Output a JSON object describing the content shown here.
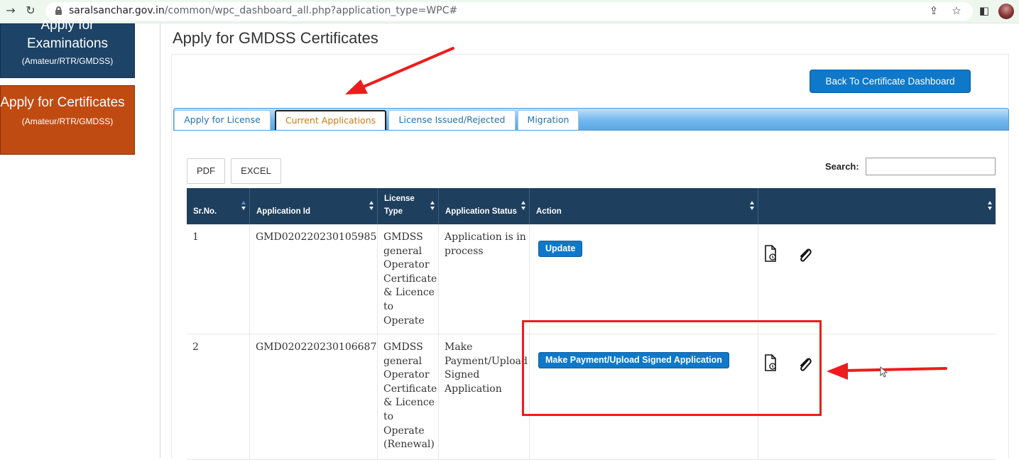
{
  "browser": {
    "url_host": "saralsanchar.gov.in",
    "url_path": "/common/wpc_dashboard_all.php?application_type=WPC#"
  },
  "sidebar": {
    "exam_title_line1": "Apply for",
    "exam_title_line2": "Examinations",
    "exam_sub": "(Amateur/RTR/GMDSS)",
    "cert_title": "Apply for Certificates",
    "cert_sub": "(Amateur/RTR/GMDSS)"
  },
  "page": {
    "title": "Apply for GMDSS Certificates",
    "back_button": "Back To Certificate Dashboard"
  },
  "tabs": [
    {
      "label": "Apply for License"
    },
    {
      "label": "Current Applications"
    },
    {
      "label": "License Issued/Rejected"
    },
    {
      "label": "Migration"
    }
  ],
  "toolbar": {
    "pdf_label": "PDF",
    "excel_label": "EXCEL",
    "search_label": "Search:",
    "search_value": ""
  },
  "table": {
    "headers": {
      "sr_no": "Sr.No.",
      "app_id": "Application Id",
      "license_type_1": "License",
      "license_type_2": "Type",
      "status": "Application Status",
      "action": "Action",
      "extra": ""
    },
    "rows": [
      {
        "sr_no": "1",
        "app_id": "GMD020220230105985",
        "license_type": "GMDSS general Operator Certificate & Licence to Operate",
        "status": "Application is in process",
        "action": "Update"
      },
      {
        "sr_no": "2",
        "app_id": "GMD020220230106687",
        "license_type": "GMDSS general Operator Certificate & Licence to Operate (Renewal)",
        "status": "Make Payment/Upload Signed Application",
        "action": "Make Payment/Upload Signed Application"
      }
    ]
  },
  "icons": [
    "forward-arrow-icon",
    "reload-icon",
    "lock-icon",
    "share-icon",
    "star-icon",
    "sidepanel-icon",
    "document-icon",
    "paperclip-icon",
    "sort-icon",
    "cursor-icon"
  ],
  "colors": {
    "accent": "#0f78c8",
    "header_bg": "#1e3f5e",
    "exam_bg": "#1d4366",
    "cert_bg": "#bf4b12",
    "active_tab": "#d17a10",
    "annotation": "#ee1c1c"
  }
}
